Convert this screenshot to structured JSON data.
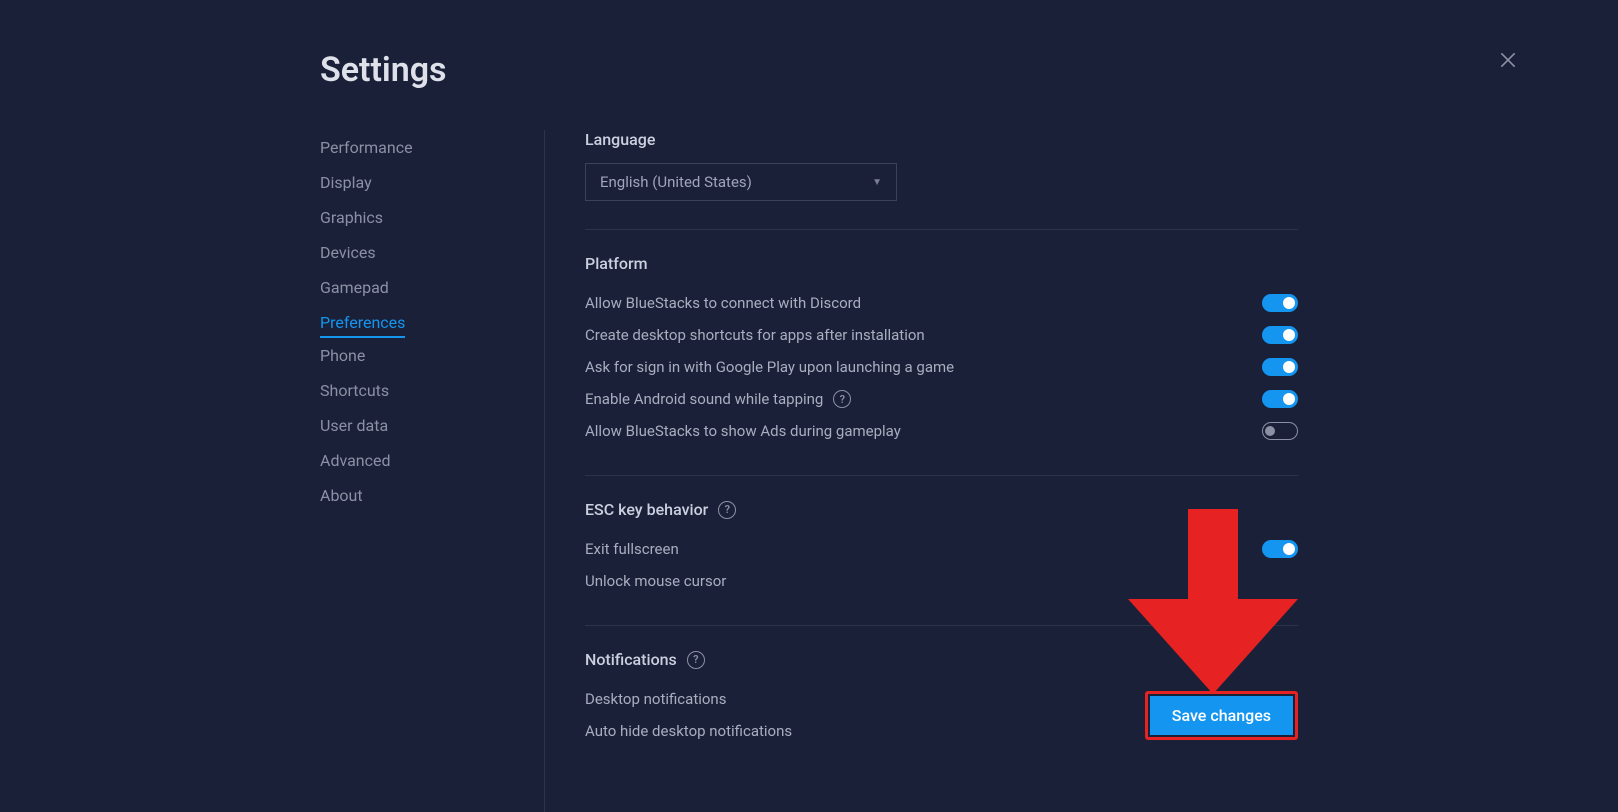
{
  "page_title": "Settings",
  "sidebar": {
    "items": [
      {
        "label": "Performance",
        "active": false
      },
      {
        "label": "Display",
        "active": false
      },
      {
        "label": "Graphics",
        "active": false
      },
      {
        "label": "Devices",
        "active": false
      },
      {
        "label": "Gamepad",
        "active": false
      },
      {
        "label": "Preferences",
        "active": true
      },
      {
        "label": "Phone",
        "active": false
      },
      {
        "label": "Shortcuts",
        "active": false
      },
      {
        "label": "User data",
        "active": false
      },
      {
        "label": "Advanced",
        "active": false
      },
      {
        "label": "About",
        "active": false
      }
    ]
  },
  "language_section": {
    "header": "Language",
    "selected": "English (United States)"
  },
  "platform_section": {
    "header": "Platform",
    "rows": [
      {
        "label": "Allow BlueStacks to connect with Discord",
        "help": false,
        "on": true
      },
      {
        "label": "Create desktop shortcuts for apps after installation",
        "help": false,
        "on": true
      },
      {
        "label": "Ask for sign in with Google Play upon launching a game",
        "help": false,
        "on": true
      },
      {
        "label": "Enable Android sound while tapping",
        "help": true,
        "on": true
      },
      {
        "label": "Allow BlueStacks to show Ads during gameplay",
        "help": false,
        "on": false
      }
    ]
  },
  "esc_section": {
    "header": "ESC key behavior",
    "help": true,
    "rows": [
      {
        "label": "Exit fullscreen",
        "on": true
      },
      {
        "label": "Unlock mouse cursor",
        "on": null
      }
    ]
  },
  "notifications_section": {
    "header": "Notifications",
    "help": true,
    "rows": [
      {
        "label": "Desktop notifications",
        "on": null
      },
      {
        "label": "Auto hide desktop notifications",
        "on": null
      }
    ]
  },
  "save_button": "Save changes"
}
